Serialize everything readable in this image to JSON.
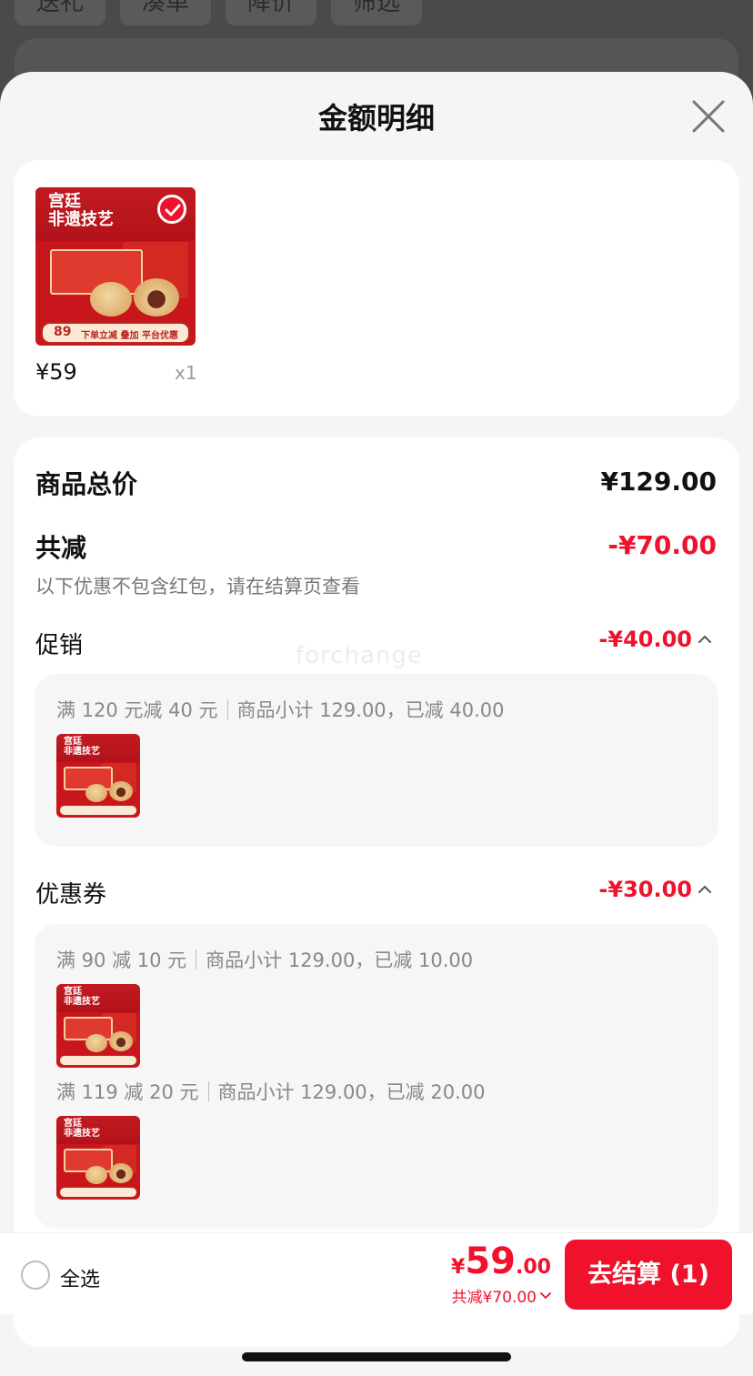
{
  "background": {
    "chips": [
      "送礼",
      "凑单",
      "降价",
      "筛选"
    ]
  },
  "sheet": {
    "title": "金额明细",
    "close_icon": "close-icon"
  },
  "product": {
    "thumb": {
      "line1": "宫廷",
      "line2": "非遗技艺",
      "badge_number": "89",
      "ribbon_text": "下单立减 叠加 平台优惠"
    },
    "price": "¥59",
    "quantity": "x1",
    "selected": true
  },
  "detail": {
    "total_label": "商品总价",
    "total_value": "¥129.00",
    "discount_label": "共减",
    "discount_value": "-¥70.00",
    "note": "以下优惠不包含红包，请在结算页查看",
    "watermark": "forchange",
    "promo": {
      "label": "促销",
      "value": "-¥40.00",
      "rules": [
        {
          "name": "满 120 元减 40 元",
          "detail": "商品小计 129.00，已减 40.00"
        }
      ]
    },
    "coupon": {
      "label": "优惠券",
      "value": "-¥30.00",
      "rules": [
        {
          "name": "满 90 减 10 元",
          "detail": "商品小计 129.00，已减 10.00"
        },
        {
          "name": "满 119 减 20 元",
          "detail": "商品小计 129.00，已减 20.00"
        }
      ]
    }
  },
  "footer": {
    "select_all": "全选",
    "currency": "¥",
    "total_int": "59",
    "total_dec": ".00",
    "saving": "共减¥70.00",
    "checkout": "去结算 (1)"
  },
  "colors": {
    "accent": "#f0112d",
    "product_red": "#c9161d"
  }
}
